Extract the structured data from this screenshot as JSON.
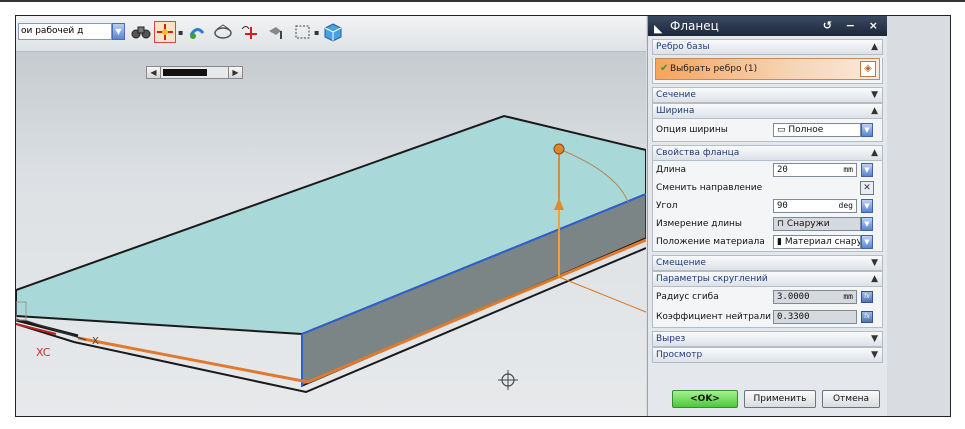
{
  "toolbar": {
    "selection_filter_value": "ои рабочей д",
    "icons": [
      "binoculars-icon",
      "snap-point-icon",
      "rotate-icon",
      "view-orient-icon",
      "wcs-icon",
      "move-icon",
      "selection-box-icon",
      "shaded-cube-icon"
    ]
  },
  "dialog": {
    "title": "Фланец",
    "sections": {
      "base_edge": {
        "label": "Ребро базы",
        "select_label": "Выбрать ребро (1)"
      },
      "section": {
        "label": "Сечение"
      },
      "width": {
        "label": "Ширина",
        "option_label": "Опция ширины",
        "option_value": "Полное"
      },
      "flange_props": {
        "label": "Свойства фланца",
        "length_label": "Длина",
        "length_value": "20",
        "length_unit": "mm",
        "reverse_label": "Сменить направление",
        "angle_label": "Угол",
        "angle_value": "90",
        "angle_unit": "deg",
        "length_measure_label": "Измерение длины",
        "length_measure_value": "Снаружи",
        "material_side_label": "Положение материала",
        "material_side_value": "Материал снару"
      },
      "offset": {
        "label": "Смещение"
      },
      "bend_params": {
        "label": "Параметры скруглений",
        "bend_radius_label": "Радиус сгиба",
        "bend_radius_value": "3.0000",
        "bend_radius_unit": "mm",
        "neutral_factor_label": "Коэффициент нейтрали",
        "neutral_factor_value": "0.3300"
      },
      "relief": {
        "label": "Вырез"
      },
      "preview": {
        "label": "Просмотр"
      }
    },
    "buttons": {
      "ok": "<OK>",
      "apply": "Применить",
      "cancel": "Отмена"
    }
  },
  "viewport": {
    "axis_x_label": "X",
    "axis_xc_label": "XC"
  },
  "colors": {
    "model_face": "#a9d8d8",
    "accent_orange": "#e07a2e",
    "title_bar": "#1c2639"
  }
}
